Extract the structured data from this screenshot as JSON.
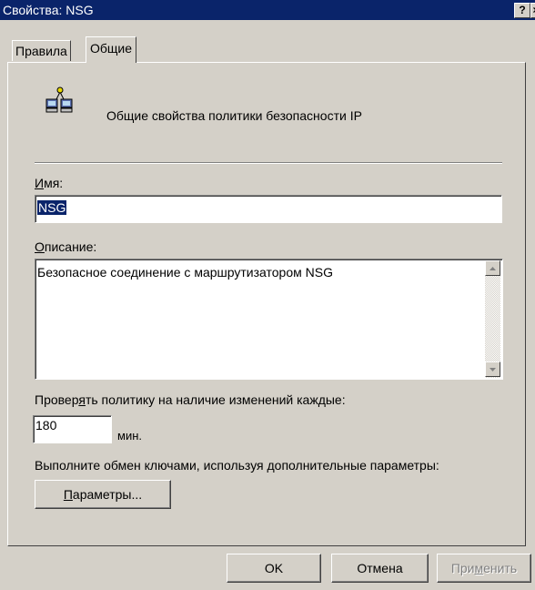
{
  "window": {
    "title": "Свойства: NSG",
    "help_label": "?",
    "close_label": "×"
  },
  "tabs": [
    {
      "label": "Правила"
    },
    {
      "label": "Общие"
    }
  ],
  "header": {
    "description": "Общие свойства политики безопасности IP"
  },
  "name_field": {
    "label_u": "И",
    "label_rest": "мя:",
    "value": "NSG"
  },
  "description_field": {
    "label_u": "О",
    "label_rest": "писание:",
    "value": "Безопасное соединение с маршрутизатором NSG"
  },
  "check_interval": {
    "label_pre": "Провер",
    "label_u": "я",
    "label_post": "ть политику на наличие изменений каждые:",
    "value": "180",
    "unit": "мин."
  },
  "key_exchange": {
    "label": "Выполните обмен ключами, используя дополнительные параметры:",
    "button_u": "П",
    "button_rest": "араметры..."
  },
  "footer": {
    "ok_label": "OK",
    "cancel_label": "Отмена",
    "apply_pre": "При",
    "apply_u": "м",
    "apply_post": "енить"
  }
}
